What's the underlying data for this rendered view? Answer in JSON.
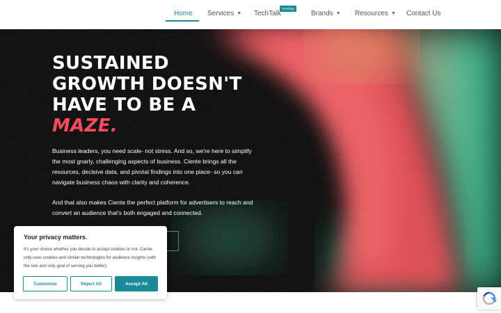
{
  "nav": {
    "items": [
      {
        "label": "Home",
        "dropdown": false
      },
      {
        "label": "Services",
        "dropdown": true
      },
      {
        "label": "TechTalk",
        "dropdown": false,
        "badge": "Trending"
      },
      {
        "label": "Brands",
        "dropdown": true
      },
      {
        "label": "Resources",
        "dropdown": true
      },
      {
        "label": "Contact Us",
        "dropdown": false
      }
    ],
    "active": "Home",
    "accent": "#1a8a99"
  },
  "hero": {
    "title_lines": [
      "SUSTAINED",
      "GROWTH DOESN'T",
      "HAVE TO BE A"
    ],
    "title_highlight": "MAZE.",
    "highlight_color": "#ff4b5c",
    "paragraph1": "Business leaders, you need scale- not stress. And so, we're here to simplify the most gnarly, challenging aspects of business. Ciente brings all the resources, decisive data, and pivotal findings into one place- so you can navigate business chaos with clarity and coherence.",
    "paragraph2": "And that also makes Ciente the perfect platform for advertisers to reach and convert an audience that's both engaged and connected."
  },
  "cookie": {
    "title": "Your privacy matters.",
    "text": "It's your choice whether you decide to accept cookies or not. Ciente only uses cookies and similar technologies for audience insights (with the one and only goal of serving you better).",
    "customize": "Customize",
    "reject": "Reject All",
    "accept": "Accept All"
  },
  "icons": {
    "dropdown": "chevron-down-icon",
    "recaptcha": "recaptcha-icon"
  }
}
